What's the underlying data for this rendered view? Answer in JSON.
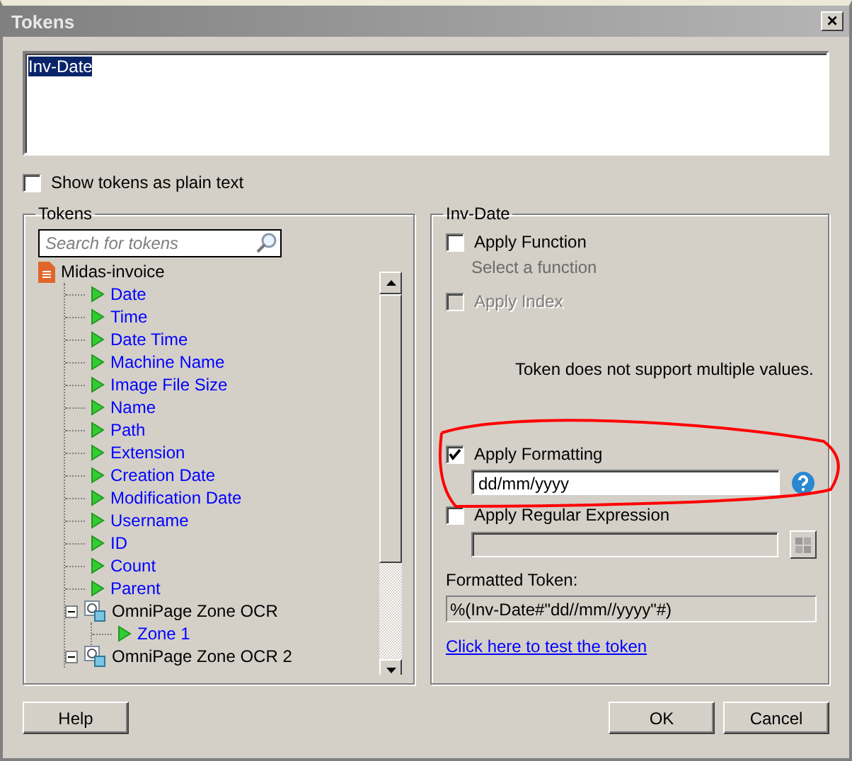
{
  "window": {
    "title": "Tokens",
    "close": "×"
  },
  "token_text": {
    "value": "Inv-Date",
    "selected": true
  },
  "show_plain": {
    "label": "Show tokens as plain text",
    "checked": false
  },
  "tokens_panel": {
    "title": "Tokens",
    "search": {
      "placeholder": "Search for tokens"
    },
    "tree": [
      {
        "label": "Midas-invoice",
        "kind": "file",
        "children": [
          {
            "label": "Date",
            "kind": "token"
          },
          {
            "label": "Time",
            "kind": "token"
          },
          {
            "label": "Date Time",
            "kind": "token"
          },
          {
            "label": "Machine Name",
            "kind": "token"
          },
          {
            "label": "Image File Size",
            "kind": "token"
          },
          {
            "label": "Name",
            "kind": "token"
          },
          {
            "label": "Path",
            "kind": "token"
          },
          {
            "label": "Extension",
            "kind": "token"
          },
          {
            "label": "Creation Date",
            "kind": "token"
          },
          {
            "label": "Modification Date",
            "kind": "token"
          },
          {
            "label": "Username",
            "kind": "token"
          },
          {
            "label": "ID",
            "kind": "token"
          },
          {
            "label": "Count",
            "kind": "token"
          },
          {
            "label": "Parent",
            "kind": "token"
          },
          {
            "label": "OmniPage Zone OCR",
            "kind": "zone",
            "expanded": true,
            "children": [
              {
                "label": "Zone 1",
                "kind": "token"
              }
            ]
          },
          {
            "label": "OmniPage Zone OCR 2",
            "kind": "zone",
            "expanded": true
          }
        ]
      }
    ]
  },
  "options_panel": {
    "title": "Inv-Date",
    "apply_function": {
      "label": "Apply Function",
      "checked": false,
      "disabled": false,
      "hint": "Select a function"
    },
    "apply_index": {
      "label": "Apply Index",
      "checked": false,
      "disabled": true
    },
    "message": "Token does not support multiple values.",
    "apply_formatting": {
      "label": "Apply Formatting",
      "checked": true,
      "disabled": false,
      "value": "dd/mm/yyyy"
    },
    "apply_regex": {
      "label": "Apply Regular Expression",
      "checked": false,
      "disabled": false
    },
    "formatted_label": "Formatted Token:",
    "formatted_value": "%(Inv-Date#\"dd//mm//yyyy\"#)",
    "test_link": "Click here to test the token"
  },
  "buttons": {
    "help": "Help",
    "ok": "OK",
    "cancel": "Cancel"
  }
}
